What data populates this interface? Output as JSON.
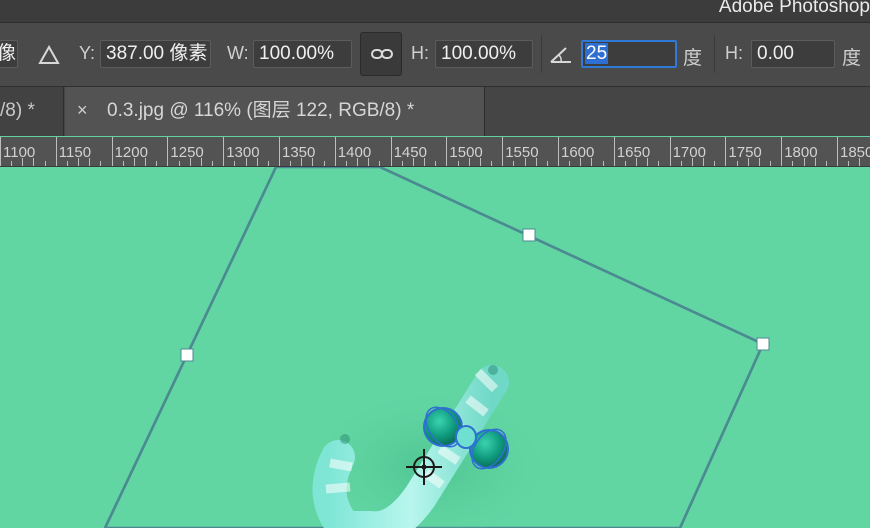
{
  "window": {
    "app_name": "Adobe Photoshop"
  },
  "options_bar": {
    "x_field_partial": "像素",
    "delta_icon": "relative-position-triangle-icon",
    "y_label": "Y:",
    "y_value": "387.00 像素",
    "w_label": "W:",
    "w_value": "100.00%",
    "link_icon": "chain-link-icon",
    "h_label": "H:",
    "h_value": "100.00%",
    "angle_icon": "rotation-angle-icon",
    "angle_value": "25",
    "angle_unit": "度",
    "hskew_label": "H:",
    "hskew_value": "0.00",
    "hskew_unit": "度"
  },
  "tabs": [
    {
      "label": "/8) *",
      "active": false
    },
    {
      "close": "×",
      "label": "0.3.jpg @ 116% (图层 122, RGB/8) *",
      "active": true
    }
  ],
  "ruler": {
    "labels": [
      "1100",
      "1150",
      "1200",
      "1250",
      "1300",
      "1350",
      "1400",
      "1450",
      "1500",
      "1550",
      "1600",
      "1650",
      "1700",
      "1750",
      "1800",
      "1850"
    ]
  },
  "colors": {
    "canvas": "#61d5a2",
    "bounding_box": "#4d8a8f",
    "selection_accent": "#2f6fd1"
  }
}
